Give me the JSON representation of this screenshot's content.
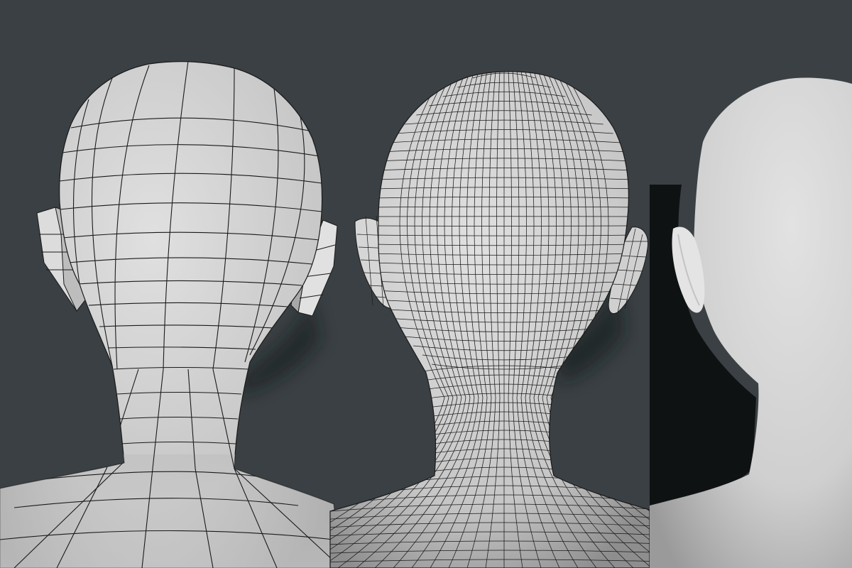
{
  "scene": {
    "background_color": "#3a4043",
    "surface_color": "#cfcfcf",
    "surface_shadow_color": "#8f8f8f",
    "wire_color": "#1a1a1a",
    "drop_shadow_color": "#0d0f10"
  },
  "models": [
    {
      "name": "low-poly-head",
      "shading": "wireframe",
      "wire_density": "low"
    },
    {
      "name": "subdivided-head",
      "shading": "wireframe",
      "wire_density": "high"
    },
    {
      "name": "smooth-head",
      "shading": "smooth",
      "wire_density": "none"
    }
  ]
}
